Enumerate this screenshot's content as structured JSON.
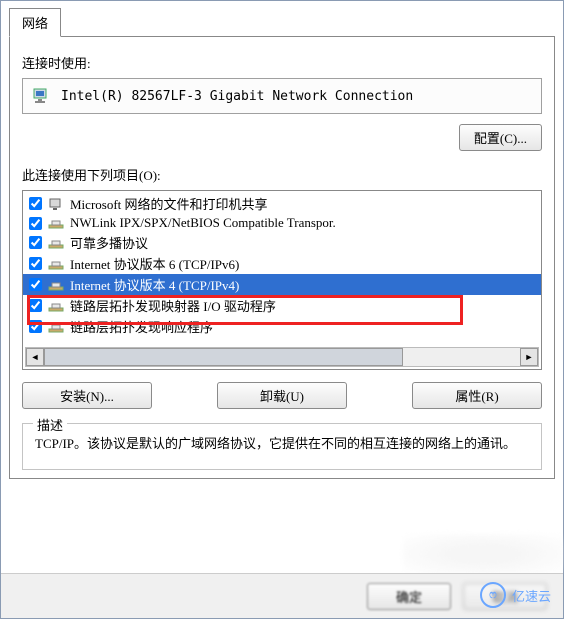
{
  "tab": {
    "label": "网络"
  },
  "adapter": {
    "label": "连接时使用:",
    "name": "Intel(R) 82567LF-3 Gigabit Network Connection",
    "configure_btn": "配置(C)..."
  },
  "items_label": "此连接使用下列项目(O):",
  "list": [
    {
      "checked": true,
      "icon": "service",
      "label": "Microsoft 网络的文件和打印机共享"
    },
    {
      "checked": true,
      "icon": "protocol",
      "label": "NWLink IPX/SPX/NetBIOS Compatible Transpor."
    },
    {
      "checked": true,
      "icon": "protocol",
      "label": "可靠多播协议"
    },
    {
      "checked": true,
      "icon": "protocol",
      "label": "Internet 协议版本 6 (TCP/IPv6)"
    },
    {
      "checked": true,
      "icon": "protocol",
      "label": "Internet 协议版本 4 (TCP/IPv4)",
      "selected": true
    },
    {
      "checked": true,
      "icon": "protocol",
      "label": "链路层拓扑发现映射器 I/O 驱动程序"
    },
    {
      "checked": true,
      "icon": "protocol",
      "label": "链路层拓扑发现响应程序"
    }
  ],
  "buttons": {
    "install": "安装(N)...",
    "uninstall": "卸载(U)",
    "properties": "属性(R)"
  },
  "description": {
    "legend": "描述",
    "text": "TCP/IP。该协议是默认的广域网络协议，它提供在不同的相互连接的网络上的通讯。"
  },
  "bottom": {
    "ok": "确定",
    "cancel": "取消"
  },
  "watermark": {
    "text": "亿速云",
    "badge": "ෆ"
  }
}
